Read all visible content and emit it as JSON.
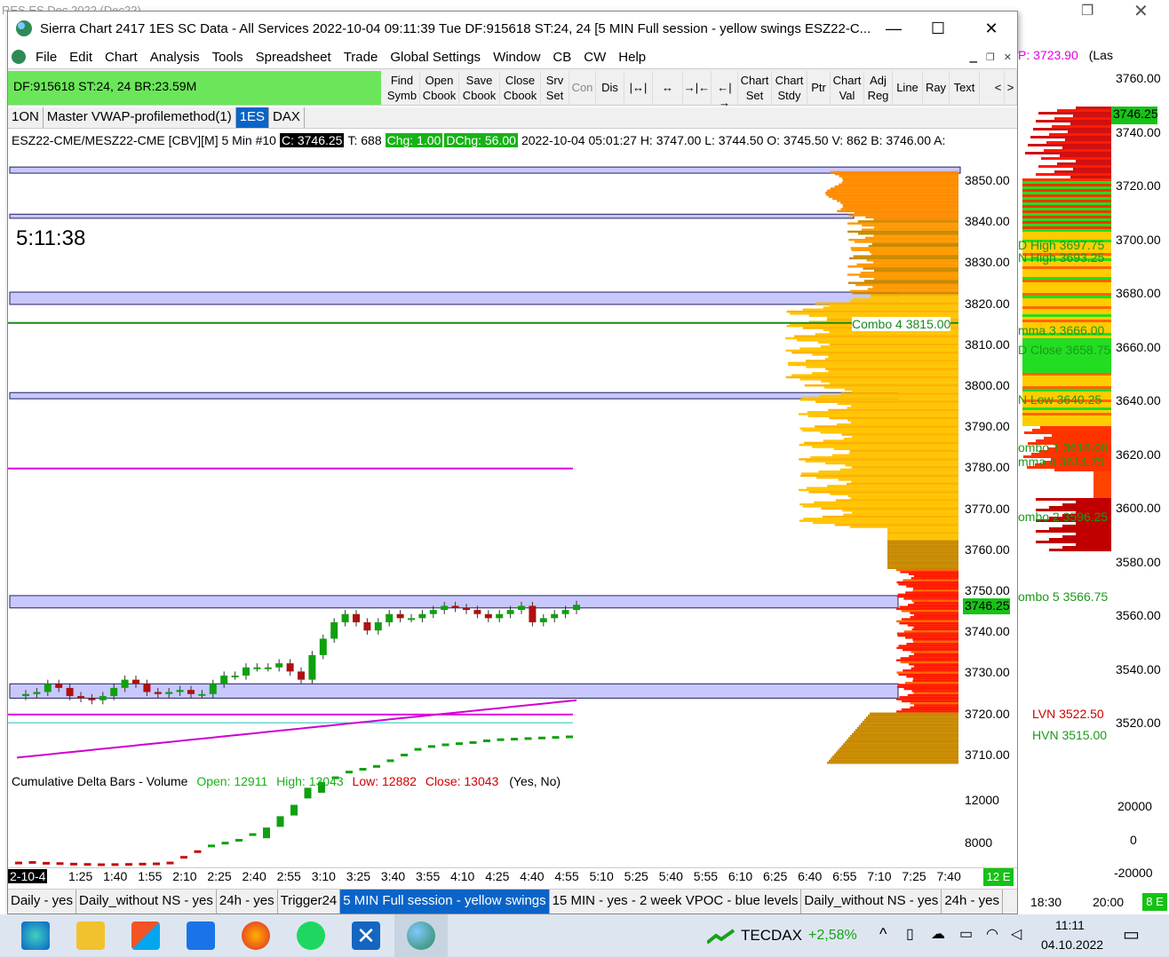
{
  "bg": {
    "title": "RES ES Dec 2022 (Dec22)",
    "price_label": "P: 3723.90",
    "price_tail": "(Las"
  },
  "window": {
    "title": "Sierra Chart 2417 1ES  SC Data - All Services 2022-10-04  09:11:39 Tue   DF:915618   ST:24, 24   [5 MIN Full session - yellow swings ESZ22-C..."
  },
  "menu": [
    "File",
    "Edit",
    "Chart",
    "Analysis",
    "Tools",
    "Spreadsheet",
    "Trade",
    "Global Settings",
    "Window",
    "CB",
    "CW",
    "Help"
  ],
  "toolbar": {
    "status": "DF:915618  ST:24, 24  BR:23.59M",
    "buttons": [
      [
        "Find",
        "Symb"
      ],
      [
        "Open",
        "Cbook"
      ],
      [
        "Save",
        "Cbook"
      ],
      [
        "Close",
        "Cbook"
      ],
      [
        "Srv",
        "Set"
      ],
      [
        "Con",
        ""
      ],
      [
        "Dis",
        ""
      ],
      [
        "|↔|",
        ""
      ],
      [
        "↔",
        ""
      ],
      [
        "→|←",
        ""
      ],
      [
        "←|→",
        ""
      ],
      [
        "Chart",
        "Set"
      ],
      [
        "Chart",
        "Stdy"
      ],
      [
        "Ptr",
        ""
      ],
      [
        "Chart",
        "Val"
      ],
      [
        "Adj",
        "Reg"
      ],
      [
        "Line",
        ""
      ],
      [
        "Ray",
        ""
      ],
      [
        "Text",
        ""
      ],
      [
        "<",
        ""
      ],
      [
        ">",
        ""
      ]
    ]
  },
  "chart_tabs": [
    "1ON",
    "Master VWAP-profilemethod(1)",
    "1ES",
    "DAX"
  ],
  "info": {
    "symbol": "ESZ22-CME/MESZ22-CME [CBV][M]  5 Min  #10",
    "close": "C: 3746.25",
    "trades": "T: 688",
    "chg": "Chg: 1.00",
    "dchg": "DChg: 56.00",
    "rest": "2022-10-04 05:01:27  H: 3747.00  L: 3744.50  O: 3745.50  V: 862  B: 3746.00  A:"
  },
  "clock": "5:11:38",
  "price_axis": [
    "3850.00",
    "3840.00",
    "3830.00",
    "3820.00",
    "3810.00",
    "3800.00",
    "3790.00",
    "3780.00",
    "3770.00",
    "3760.00",
    "3750.00",
    "3740.00",
    "3730.00",
    "3720.00",
    "3710.00"
  ],
  "last_price": "3746.25",
  "combo4": "Combo 4  3815.00",
  "delta": {
    "title": "Cumulative Delta Bars - Volume",
    "open": "Open: 12911",
    "high": "High: 13043",
    "low": "Low: 12882",
    "close": "Close: 13043",
    "flags": "(Yes, No)",
    "axis": [
      "12000",
      "8000"
    ]
  },
  "time_axis": [
    "2-10-4",
    "1:25",
    "1:40",
    "1:55",
    "2:10",
    "2:25",
    "2:40",
    "2:55",
    "3:10",
    "3:25",
    "3:40",
    "3:55",
    "4:10",
    "4:25",
    "4:40",
    "4:55",
    "5:10",
    "5:25",
    "5:40",
    "5:55",
    "6:10",
    "6:25",
    "6:40",
    "6:55",
    "7:10",
    "7:25",
    "7:40"
  ],
  "time_badge": "12 E",
  "bottom_tabs": [
    "Daily - yes",
    "Daily_without NS - yes",
    "24h - yes",
    "Trigger24",
    "5 MIN Full session - yellow swings",
    "15 MIN - yes - 2 week VPOC - blue levels",
    "Daily_without NS - yes",
    "24h - yes"
  ],
  "right": {
    "axis": [
      "3760.00",
      "3740.00",
      "3720.00",
      "3700.00",
      "3680.00",
      "3660.00",
      "3640.00",
      "3620.00",
      "3600.00",
      "3580.00",
      "3560.00",
      "3540.00",
      "3520.00"
    ],
    "last": "3746.25",
    "labels": [
      [
        "D High  3697.75",
        "#1a9a1a"
      ],
      [
        "N High  3693.25",
        "#1a9a1a"
      ],
      [
        "mma 3  3666.00",
        "#1a9a1a"
      ],
      [
        "D Close  3658.75",
        "#1a9a1a"
      ],
      [
        "N Low  3640.25",
        "#1a9a1a"
      ],
      [
        "ombo 1  3618.00",
        "#1a9a1a"
      ],
      [
        "mma 4  3614.75",
        "#1a9a1a"
      ],
      [
        "ombo 2  3596.25",
        "#1a9a1a"
      ],
      [
        "ombo 5  3566.75",
        "#1a9a1a"
      ],
      [
        "LVN  3522.50",
        "#d00000"
      ],
      [
        "HVN  3515.00",
        "#1a9a1a"
      ]
    ],
    "delta_axis": [
      "20000",
      "0",
      "-20000"
    ],
    "time": [
      "18:30",
      "20:00"
    ],
    "badge": "8 E"
  },
  "taskbar": {
    "ticker": "TECDAX",
    "change": "+2,58%",
    "time": "11:11",
    "date": "04.10.2022"
  }
}
